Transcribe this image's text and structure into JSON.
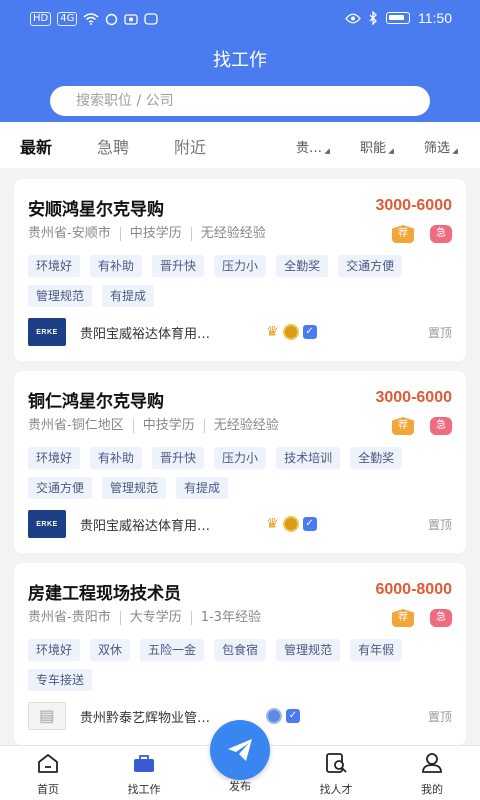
{
  "status_bar": {
    "left_icons": [
      "HD",
      "4G",
      "wifi-icon",
      "sync-icon",
      "camera-icon",
      "app-icon"
    ],
    "time": "11:50"
  },
  "header": {
    "title": "找工作",
    "search_placeholder": "搜索职位 / 公司"
  },
  "tabs": [
    {
      "label": "最新",
      "active": true
    },
    {
      "label": "急聘",
      "active": false
    },
    {
      "label": "附近",
      "active": false
    }
  ],
  "filters": [
    "贵…",
    "职能",
    "筛选"
  ],
  "jobs": [
    {
      "title": "安顺鸿星尔克导购",
      "salary": "3000-6000",
      "location": "贵州省-安顺市",
      "education": "中技学历",
      "experience": "无经验经验",
      "badges": [
        "荐",
        "急"
      ],
      "tags": [
        "环境好",
        "有补助",
        "晋升快",
        "压力小",
        "全勤奖",
        "交通方便",
        "管理规范",
        "有提成"
      ],
      "company": "贵阳宝威裕达体育用…",
      "logo_text": "ERKE",
      "pin": "置顶"
    },
    {
      "title": "铜仁鸿星尔克导购",
      "salary": "3000-6000",
      "location": "贵州省-铜仁地区",
      "education": "中技学历",
      "experience": "无经验经验",
      "badges": [
        "荐",
        "急"
      ],
      "tags": [
        "环境好",
        "有补助",
        "晋升快",
        "压力小",
        "技术培训",
        "全勤奖",
        "交通方便",
        "管理规范",
        "有提成"
      ],
      "company": "贵阳宝威裕达体育用…",
      "logo_text": "ERKE",
      "pin": "置顶"
    },
    {
      "title": "房建工程现场技术员",
      "salary": "6000-8000",
      "location": "贵州省-贵阳市",
      "education": "大专学历",
      "experience": "1-3年经验",
      "badges": [
        "荐",
        "急"
      ],
      "tags": [
        "环境好",
        "双休",
        "五险一金",
        "包食宿",
        "管理规范",
        "有年假",
        "专车接送"
      ],
      "company": "贵州黔泰艺辉物业管…",
      "logo_text": "",
      "pin": "置顶"
    }
  ],
  "tabbar": [
    {
      "label": "首页",
      "icon": "home-icon"
    },
    {
      "label": "找工作",
      "icon": "briefcase-icon"
    },
    {
      "label": "发布",
      "icon": "send-icon"
    },
    {
      "label": "找人才",
      "icon": "search-talent-icon"
    },
    {
      "label": "我的",
      "icon": "profile-icon"
    }
  ],
  "colors": {
    "primary": "#4a7cf0",
    "salary": "#e15b36",
    "recommend": "#f3a53c",
    "urgent": "#f06a80"
  }
}
